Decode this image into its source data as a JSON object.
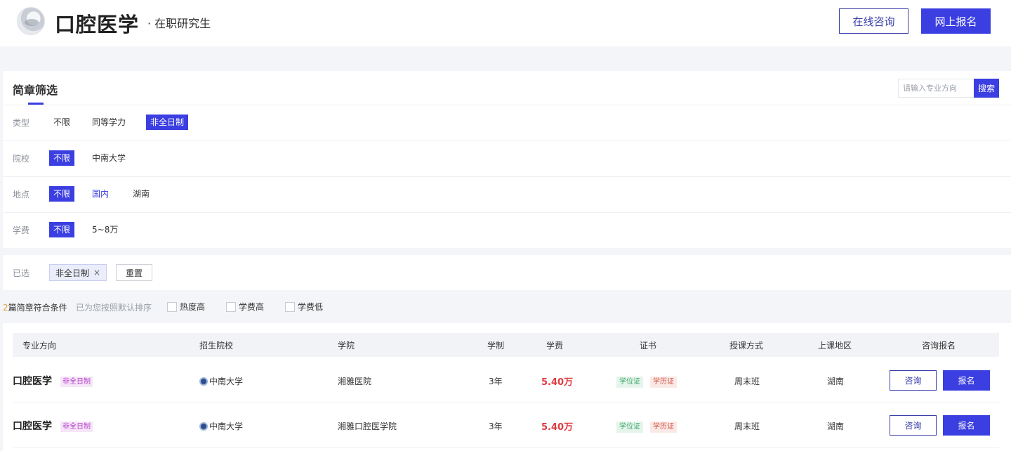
{
  "header": {
    "title": "口腔医学",
    "subtitle": "· 在职研究生",
    "consult_label": "在线咨询",
    "signup_label": "网上报名"
  },
  "filter": {
    "title": "简章筛选",
    "search_placeholder": "请输入专业方向",
    "search_label": "搜索",
    "rows": {
      "type": {
        "label": "类型",
        "options": [
          "不限",
          "同等学力",
          "非全日制"
        ]
      },
      "school": {
        "label": "院校",
        "options": [
          "不限",
          "中南大学"
        ]
      },
      "location": {
        "label": "地点",
        "options": [
          "不限",
          "国内",
          "湖南"
        ]
      },
      "fee": {
        "label": "学费",
        "options": [
          "不限",
          "5~8万"
        ]
      }
    }
  },
  "selected": {
    "label": "已选",
    "chip": "非全日制",
    "chip_remove": "×",
    "reset_label": "重置"
  },
  "results": {
    "count": "2",
    "count_suffix": "篇简章符合条件",
    "hint": "已为您按照默认排序",
    "sorts": [
      "热度高",
      "学费高",
      "学费低"
    ]
  },
  "table": {
    "headers": [
      "专业方向",
      "招生院校",
      "学院",
      "学制",
      "学费",
      "证书",
      "授课方式",
      "上课地区",
      "咨询报名"
    ],
    "rows": [
      {
        "major": "口腔医学",
        "type": "非全日制",
        "school": "中南大学",
        "college": "湘雅医院",
        "duration": "3年",
        "fee": "5.40万",
        "cert1": "学位证",
        "cert2": "学历证",
        "mode": "周末班",
        "region": "湖南",
        "consult": "咨询",
        "signup": "报名"
      },
      {
        "major": "口腔医学",
        "type": "非全日制",
        "school": "中南大学",
        "college": "湘雅口腔医学院",
        "duration": "3年",
        "fee": "5.40万",
        "cert1": "学位证",
        "cert2": "学历证",
        "mode": "周末班",
        "region": "湖南",
        "consult": "咨询",
        "signup": "报名"
      }
    ]
  },
  "colors": {
    "accent": "#3b3ee0",
    "fee_red": "#e0393e",
    "degree_green": "#3aa56a",
    "diploma_red": "#d0574a",
    "type_tag_purple": "#b23bc7"
  }
}
